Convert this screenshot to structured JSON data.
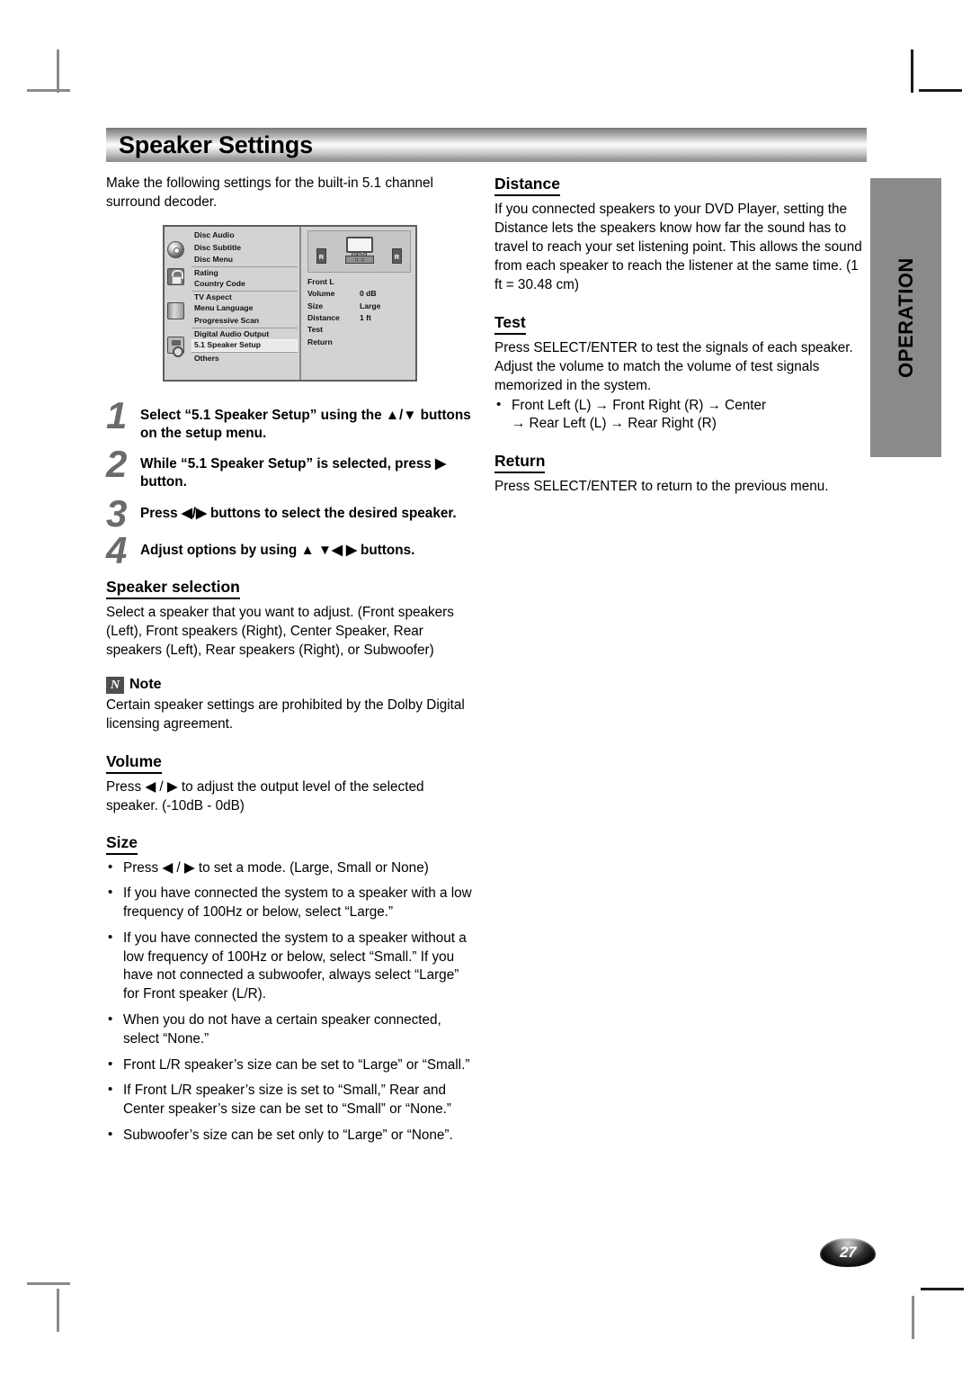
{
  "document": {
    "title": "Speaker Settings",
    "page_number": "27",
    "side_tab": "OPERATION"
  },
  "intro": "Make the following settings for the built-in 5.1 channel surround decoder.",
  "setup_menu": {
    "left_items": [
      "Disc Audio",
      "Disc Subtitle",
      "Disc Menu",
      "Rating",
      "Country Code",
      "TV Aspect",
      "Menu Language",
      "Progressive Scan",
      "Digital Audio Output",
      "5.1 Speaker Setup",
      "Others"
    ],
    "selected_item": "5.1 Speaker Setup",
    "icons": [
      "disc-icon",
      "lock-icon",
      "tv-icon",
      "audio-output-icon"
    ],
    "diagram": {
      "rear_left_label": "R",
      "rear_right_label": "R"
    },
    "right_panel": {
      "speaker": "Front L",
      "rows": [
        {
          "key": "Volume",
          "value": "0 dB"
        },
        {
          "key": "Size",
          "value": "Large"
        },
        {
          "key": "Distance",
          "value": "1 ft"
        },
        {
          "key": "Test",
          "value": ""
        },
        {
          "key": "Return",
          "value": ""
        }
      ]
    }
  },
  "steps": [
    {
      "num": "1",
      "text": "Select “5.1 Speaker Setup” using the ▲/▼ buttons on the setup menu."
    },
    {
      "num": "2",
      "text": "While “5.1 Speaker Setup” is selected, press ▶ button."
    },
    {
      "num": "3",
      "text": "Press ◀/▶ buttons to select the desired speaker."
    },
    {
      "num": "4",
      "text": "Adjust options by using ▲ ▼◀ ▶ buttons."
    }
  ],
  "speaker_selection": {
    "heading": "Speaker selection",
    "body": "Select a speaker that you want to adjust. (Front speakers (Left), Front speakers (Right), Center Speaker, Rear speakers (Left), Rear  speakers (Right), or Subwoofer)"
  },
  "note": {
    "icon_letter": "N",
    "label": "Note",
    "body": "Certain speaker settings are prohibited by the Dolby Digital licensing agreement."
  },
  "volume": {
    "heading": "Volume",
    "body": "Press ◀ / ▶ to adjust the output level of the selected speaker. (-10dB - 0dB)"
  },
  "size": {
    "heading": "Size",
    "bullets": [
      "Press ◀ / ▶ to set a mode. (Large, Small or None)",
      "If you have connected the system to a speaker with a low frequency of 100Hz or below, select “Large.”",
      "If you have connected the system to a speaker without a low frequency of 100Hz or below, select “Small.” If you have not connected a subwoofer, always select “Large” for Front speaker (L/R).",
      "When you do not have a certain speaker connected, select “None.”",
      "Front L/R speaker’s size can be set to “Large” or “Small.”",
      "If Front L/R speaker’s size is set to “Small,” Rear and Center speaker’s size can be set to “Small” or “None.”",
      "Subwoofer’s size can be set only to “Large” or “None”."
    ]
  },
  "distance": {
    "heading": "Distance",
    "body": "If you connected speakers to your DVD Player, setting the Distance lets the speakers know how far the sound has to travel to reach your set listening point. This allows the sound from each speaker to reach the listener at the same time. (1 ft = 30.48 cm)"
  },
  "test": {
    "heading": "Test",
    "body": "Press SELECT/ENTER to test the signals of each speaker. Adjust the volume to match the volume of test signals memorized in the system.",
    "bullet_line1": "Front Left (L) → Front Right (R) → Center",
    "bullet_line2": "→ Rear Left (L)  → Rear Right (R)"
  },
  "return": {
    "heading": "Return",
    "body": "Press SELECT/ENTER to return to the previous menu."
  }
}
